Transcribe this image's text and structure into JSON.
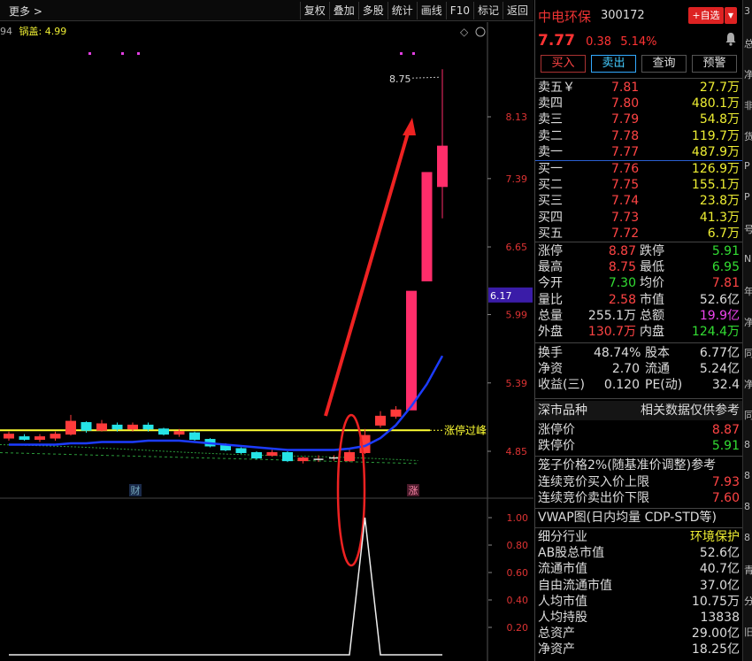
{
  "toolbar": {
    "more": "更多 >",
    "buttons": [
      "复权",
      "叠加",
      "多股",
      "统计",
      "画线",
      "F10",
      "标记",
      "返回"
    ]
  },
  "legend": {
    "prefix": "94",
    "label": "锅盖:",
    "value": "4.99"
  },
  "chart_data": {
    "type": "candlestick",
    "y_ticks": [
      "8.13",
      "7.39",
      "6.65",
      "5.99",
      "5.39",
      "4.85"
    ],
    "current_price_label": "6.17",
    "peak_label": "8.75",
    "threshold_label": "涨停过峰",
    "markers": [
      "财",
      "涨"
    ],
    "indicator_ticks": [
      "1.00",
      "0.80",
      "0.60",
      "0.40",
      "0.20"
    ],
    "candles": [
      {
        "o": 4.95,
        "c": 4.98,
        "h": 5.0,
        "l": 4.93
      },
      {
        "o": 4.96,
        "c": 4.94,
        "h": 4.98,
        "l": 4.93
      },
      {
        "o": 4.94,
        "c": 4.96,
        "h": 4.98,
        "l": 4.92
      },
      {
        "o": 4.95,
        "c": 4.98,
        "h": 5.0,
        "l": 4.93
      },
      {
        "o": 4.98,
        "c": 5.08,
        "h": 5.13,
        "l": 4.97
      },
      {
        "o": 5.07,
        "c": 5.01,
        "h": 5.08,
        "l": 4.99
      },
      {
        "o": 5.01,
        "c": 5.06,
        "h": 5.09,
        "l": 5.0
      },
      {
        "o": 5.05,
        "c": 5.02,
        "h": 5.07,
        "l": 5.0
      },
      {
        "o": 5.02,
        "c": 5.05,
        "h": 5.07,
        "l": 5.0
      },
      {
        "o": 5.05,
        "c": 5.02,
        "h": 5.07,
        "l": 5.0
      },
      {
        "o": 5.02,
        "c": 4.98,
        "h": 5.03,
        "l": 4.97
      },
      {
        "o": 4.98,
        "c": 5.0,
        "h": 5.02,
        "l": 4.96
      },
      {
        "o": 4.99,
        "c": 4.94,
        "h": 5.0,
        "l": 4.93
      },
      {
        "o": 4.94,
        "c": 4.89,
        "h": 4.95,
        "l": 4.88
      },
      {
        "o": 4.9,
        "c": 4.86,
        "h": 4.91,
        "l": 4.85
      },
      {
        "o": 4.87,
        "c": 4.84,
        "h": 4.88,
        "l": 4.83
      },
      {
        "o": 4.84,
        "c": 4.8,
        "h": 4.85,
        "l": 4.79
      },
      {
        "o": 4.82,
        "c": 4.84,
        "h": 4.86,
        "l": 4.81
      },
      {
        "o": 4.84,
        "c": 4.78,
        "h": 4.85,
        "l": 4.77
      },
      {
        "o": 4.78,
        "c": 4.8,
        "h": 4.81,
        "l": 4.76
      },
      {
        "o": 4.79,
        "c": 4.79,
        "h": 4.82,
        "l": 4.77
      },
      {
        "o": 4.8,
        "c": 4.8,
        "h": 4.82,
        "l": 4.78
      },
      {
        "o": 4.78,
        "c": 4.84,
        "h": 4.86,
        "l": 4.77
      },
      {
        "o": 4.84,
        "c": 4.97,
        "h": 5.02,
        "l": 4.83
      },
      {
        "o": 5.05,
        "c": 5.12,
        "h": 5.16,
        "l": 5.03
      },
      {
        "o": 5.12,
        "c": 5.17,
        "h": 5.2,
        "l": 5.1
      },
      {
        "o": 5.17,
        "c": 6.21,
        "h": 6.21,
        "l": 5.17
      },
      {
        "o": 6.31,
        "c": 7.46,
        "h": 7.46,
        "l": 6.31
      },
      {
        "o": 7.3,
        "c": 7.77,
        "h": 8.75,
        "l": 6.95
      }
    ],
    "ma_blue": [
      4.9,
      4.9,
      4.9,
      4.9,
      4.91,
      4.91,
      4.92,
      4.92,
      4.92,
      4.93,
      4.93,
      4.93,
      4.92,
      4.91,
      4.9,
      4.89,
      4.88,
      4.87,
      4.86,
      4.86,
      4.86,
      4.86,
      4.87,
      4.89,
      4.95,
      5.05,
      5.2,
      5.38,
      5.62
    ],
    "guide_level": 5.01,
    "indicator": [
      0,
      0,
      0,
      0,
      0,
      0,
      0,
      0,
      0,
      0,
      0,
      0,
      0,
      0,
      0,
      0,
      0,
      0,
      0,
      0,
      0,
      0,
      0,
      1,
      0,
      0,
      0,
      0,
      0
    ]
  },
  "stock": {
    "name": "中电环保",
    "code": "300172",
    "add_label": "+自选",
    "price": "7.77",
    "change": "0.38",
    "change_pct": "5.14%",
    "actions": [
      "买入",
      "卖出",
      "查询",
      "预警"
    ]
  },
  "orderbook": {
    "asks": [
      {
        "label": "卖五￥",
        "price": "7.81",
        "vol": "27.7万"
      },
      {
        "label": "卖四",
        "price": "7.80",
        "vol": "480.1万"
      },
      {
        "label": "卖三",
        "price": "7.79",
        "vol": "54.8万"
      },
      {
        "label": "卖二",
        "price": "7.78",
        "vol": "119.7万"
      },
      {
        "label": "卖一",
        "price": "7.77",
        "vol": "487.9万"
      }
    ],
    "bids": [
      {
        "label": "买一",
        "price": "7.76",
        "vol": "126.9万"
      },
      {
        "label": "买二",
        "price": "7.75",
        "vol": "155.1万"
      },
      {
        "label": "买三",
        "price": "7.74",
        "vol": "23.8万"
      },
      {
        "label": "买四",
        "price": "7.73",
        "vol": "41.3万"
      },
      {
        "label": "买五",
        "price": "7.72",
        "vol": "6.7万"
      }
    ]
  },
  "stats": [
    [
      "涨停",
      "8.87",
      "跌停",
      "5.91"
    ],
    [
      "最高",
      "8.75",
      "最低",
      "6.95"
    ],
    [
      "今开",
      "7.30",
      "均价",
      "7.81"
    ],
    [
      "量比",
      "2.58",
      "市值",
      "52.6亿"
    ],
    [
      "总量",
      "255.1万",
      "总额",
      "19.9亿"
    ],
    [
      "外盘",
      "130.7万",
      "内盘",
      "124.4万"
    ]
  ],
  "stats2": [
    [
      "换手",
      "48.74%",
      "股本",
      "6.77亿"
    ],
    [
      "净资",
      "2.70",
      "流通",
      "5.24亿"
    ],
    [
      "收益(三)",
      "0.120",
      "PE(动)",
      "32.4"
    ]
  ],
  "market": {
    "title": "深市品种",
    "note": "相关数据仅供参考",
    "rows": [
      [
        "涨停价",
        "8.87"
      ],
      [
        "跌停价",
        "5.91"
      ]
    ]
  },
  "cage": {
    "title": "笼子价格2%(随基准价调整)参考",
    "rows": [
      [
        "连续竞价买入价上限",
        "7.93"
      ],
      [
        "连续竞价卖出价下限",
        "7.60"
      ]
    ]
  },
  "vwap": {
    "title": "VWAP图(日内均量 CDP-STD等)"
  },
  "info": {
    "rows": [
      [
        "细分行业",
        "环境保护"
      ],
      [
        "AB股总市值",
        "52.6亿"
      ],
      [
        "流通市值",
        "40.7亿"
      ],
      [
        "自由流通市值",
        "37.0亿"
      ],
      [
        "人均市值",
        "10.75万"
      ],
      [
        "人均持股",
        "13838"
      ],
      [
        "总资产",
        "29.00亿"
      ],
      [
        "净资产",
        "18.25亿"
      ]
    ]
  },
  "edge_chars": [
    "3",
    "总",
    "净",
    "非",
    "货",
    "P",
    "P",
    "号",
    "N",
    "年",
    "净",
    "同",
    "净",
    "同",
    "8",
    "8",
    "8",
    "8",
    "青",
    "分",
    "旧"
  ]
}
